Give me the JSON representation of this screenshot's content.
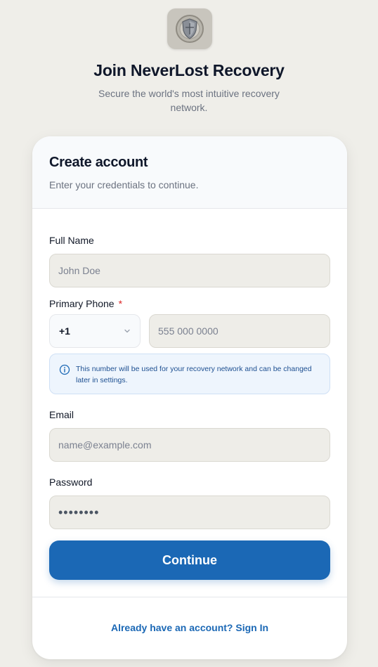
{
  "app": {
    "title": "Join NeverLost Recovery",
    "subtitle": "Secure the world's most intuitive recovery network.",
    "logo_icon": "shield-emblem-icon"
  },
  "card": {
    "title": "Create account",
    "subtitle": "Enter your credentials to continue."
  },
  "form": {
    "full_name": {
      "label": "Full Name",
      "placeholder": "John Doe",
      "value": ""
    },
    "phone": {
      "label": "Primary Phone",
      "required_mark": "*",
      "country_code": "+1",
      "placeholder": "555 000 0000",
      "value": "",
      "info": "This number will be used for your recovery network and can be changed later in settings."
    },
    "email": {
      "label": "Email",
      "placeholder": "name@example.com",
      "value": ""
    },
    "password": {
      "label": "Password",
      "value": "password"
    }
  },
  "actions": {
    "continue_label": "Continue",
    "signin_text": "Already have an account? Sign In"
  },
  "colors": {
    "background": "#efeee9",
    "accent": "#1b68b5",
    "required": "#dc2626",
    "info_bg": "#eef5fd"
  }
}
